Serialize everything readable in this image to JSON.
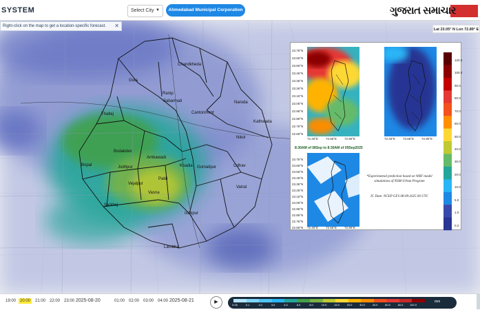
{
  "app": {
    "brand": "SYSTEM",
    "city_select": "Select City",
    "city_pill": "Ahmedabad Municipal Corporation",
    "logo_text": "ગુજરાત સમાચાર"
  },
  "map": {
    "hint": "Right-click on the map to get a location-specific forecast.",
    "coordinates": "Lat 23.05° N  Lon 72.89° E",
    "place_labels": [
      "Chandkheda",
      "Gota",
      "Ranip",
      "Sabarmati",
      "Naroda",
      "Cantonment",
      "Thaltej",
      "Kathwada",
      "Nikol",
      "Bodakdev",
      "Ambawadi",
      "Bopal",
      "Jodhpur",
      "Khadia",
      "Gomatipur",
      "Odhav",
      "Paldi",
      "Vejalpur",
      "Vasna",
      "Vatral",
      "Sarkhej",
      "Isanpur",
      "Lambha"
    ]
  },
  "panel": {
    "y_ticks": [
      "23.76°N",
      "23.66°N",
      "23.56°N",
      "23.46°N",
      "23.36°N",
      "23.26°N",
      "23.16°N",
      "23.06°N",
      "22.96°N",
      "22.86°N",
      "22.76°N",
      "22.66°N"
    ],
    "x_ticks": [
      "72.40°E",
      "72.66°E",
      "72.90°E"
    ],
    "date_caption": "8:30AM of 08Sep to 8:30AM of 09Sep2025",
    "note": "*Experimental prediction based on WRF model simulations of NSM-Urban Program",
    "ic_date": "IC Date: NCEP GFS 08-09-2025 00 UTC",
    "colorbar_labels": [
      "120.0",
      "100.0",
      "90.0",
      "80.0",
      "70.0",
      "60.0",
      "50.0",
      "40.0",
      "30.0",
      "20.0",
      "10.0",
      "5.0",
      "1.0",
      "0.2"
    ],
    "colorbar_colors": [
      "#5a0000",
      "#8b0000",
      "#c40000",
      "#e53935",
      "#f4511e",
      "#ff8f00",
      "#fdd835",
      "#c0ca33",
      "#66bb6a",
      "#26a69a",
      "#29b6f6",
      "#1e88e5",
      "#3949ab",
      "#283593"
    ]
  },
  "timeline": {
    "times_left": [
      "19:00",
      "20:00",
      "21:00",
      "22:00",
      "23:00"
    ],
    "active_time": "20:00",
    "date_1": "2025-08-20",
    "times_mid": [
      "01:00",
      "02:00",
      "03:00",
      "04:00"
    ],
    "date_2": "2025-08-21",
    "legend_values": [
      "0.05",
      "0.1",
      "1.0",
      "3.0",
      "4.0",
      "6.0",
      "8.0",
      "10.0",
      "15.0",
      "20.0",
      "30.0",
      "40.0",
      "60.0",
      "80.0",
      "100.0"
    ],
    "legend_colors": [
      "#b3e5fc",
      "#81d4fa",
      "#4fc3f7",
      "#29b6f6",
      "#26a69a",
      "#43a047",
      "#7cb342",
      "#c0ca33",
      "#fdd835",
      "#ffb300",
      "#fb8c00",
      "#f4511e",
      "#e53935",
      "#c62828",
      "#8e0000"
    ],
    "legend_unit": "mm"
  }
}
